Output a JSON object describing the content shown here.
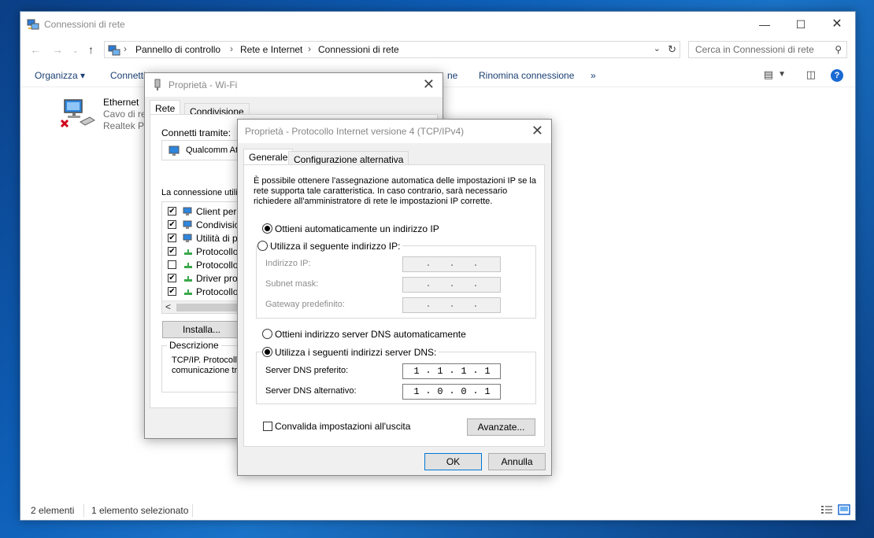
{
  "explorer": {
    "title": "Connessioni di rete",
    "breadcrumb": [
      "Pannello di controllo",
      "Rete e Internet",
      "Connessioni di rete"
    ],
    "search_placeholder": "Cerca in Connessioni di rete",
    "toolbar": {
      "organize": "Organizza ▾",
      "connect_partial": "Connetti",
      "rename": "Rinomina connessione",
      "hidden_tail": "ne",
      "more": "»"
    },
    "items": [
      {
        "name": "Ethernet",
        "line1": "Cavo di re",
        "line2": "Realtek PC"
      }
    ],
    "status": {
      "count": "2 elementi",
      "selected": "1 elemento selezionato"
    }
  },
  "wifi_dialog": {
    "title": "Proprietà - Wi-Fi",
    "tabs": [
      "Rete",
      "Condivisione"
    ],
    "connect_using_label": "Connetti tramite:",
    "adapter": "Qualcomm Ath",
    "uses_label": "La connessione utiliz",
    "list": [
      {
        "checked": true,
        "text": "Client per re"
      },
      {
        "checked": true,
        "text": "Condivision"
      },
      {
        "checked": true,
        "text": "Utilità di pia"
      },
      {
        "checked": true,
        "text": "Protocollo I"
      },
      {
        "checked": false,
        "text": "Protocollo M"
      },
      {
        "checked": true,
        "text": "Driver proto"
      },
      {
        "checked": true,
        "text": "Protocollo I"
      }
    ],
    "scroll_left": "<",
    "install_button": "Installa...",
    "description_legend": "Descrizione",
    "description_text": [
      "TCP/IP. Protocoll",
      "comunicazione tra"
    ]
  },
  "ipv4_dialog": {
    "title": "Proprietà - Protocollo Internet versione 4 (TCP/IPv4)",
    "tabs": [
      "Generale",
      "Configurazione alternativa"
    ],
    "description": [
      "È possibile ottenere l'assegnazione automatica delle impostazioni IP se la",
      "rete supporta tale caratteristica. In caso contrario, sarà necessario",
      "richiedere all'amministratore di rete le impostazioni IP corrette."
    ],
    "ip_auto": {
      "label": "Ottieni automaticamente un indirizzo IP",
      "selected": true
    },
    "ip_manual": {
      "label": "Utilizza il seguente indirizzo IP:",
      "selected": false
    },
    "ip_fields": [
      {
        "label": "Indirizzo IP:",
        "octets": [
          "",
          "",
          "",
          ""
        ]
      },
      {
        "label": "Subnet mask:",
        "octets": [
          "",
          "",
          "",
          ""
        ]
      },
      {
        "label": "Gateway predefinito:",
        "octets": [
          "",
          "",
          "",
          ""
        ]
      }
    ],
    "dns_auto": {
      "label": "Ottieni indirizzo server DNS automaticamente",
      "selected": false
    },
    "dns_manual": {
      "label": "Utilizza i seguenti indirizzi server DNS:",
      "selected": true
    },
    "dns_fields": [
      {
        "label": "Server DNS preferito:",
        "octets": [
          "1",
          "1",
          "1",
          "1"
        ]
      },
      {
        "label": "Server DNS alternativo:",
        "octets": [
          "1",
          "0",
          "0",
          "1"
        ]
      }
    ],
    "validate": {
      "label": "Convalida impostazioni all'uscita",
      "checked": false
    },
    "advanced_button": "Avanzate...",
    "ok_button": "OK",
    "cancel_button": "Annulla"
  },
  "colors": {
    "desktop_accent": "#0e5fb8",
    "link_text": "#1a3f73",
    "focus_border": "#0078d7",
    "help_icon": "#1a6ad4"
  }
}
